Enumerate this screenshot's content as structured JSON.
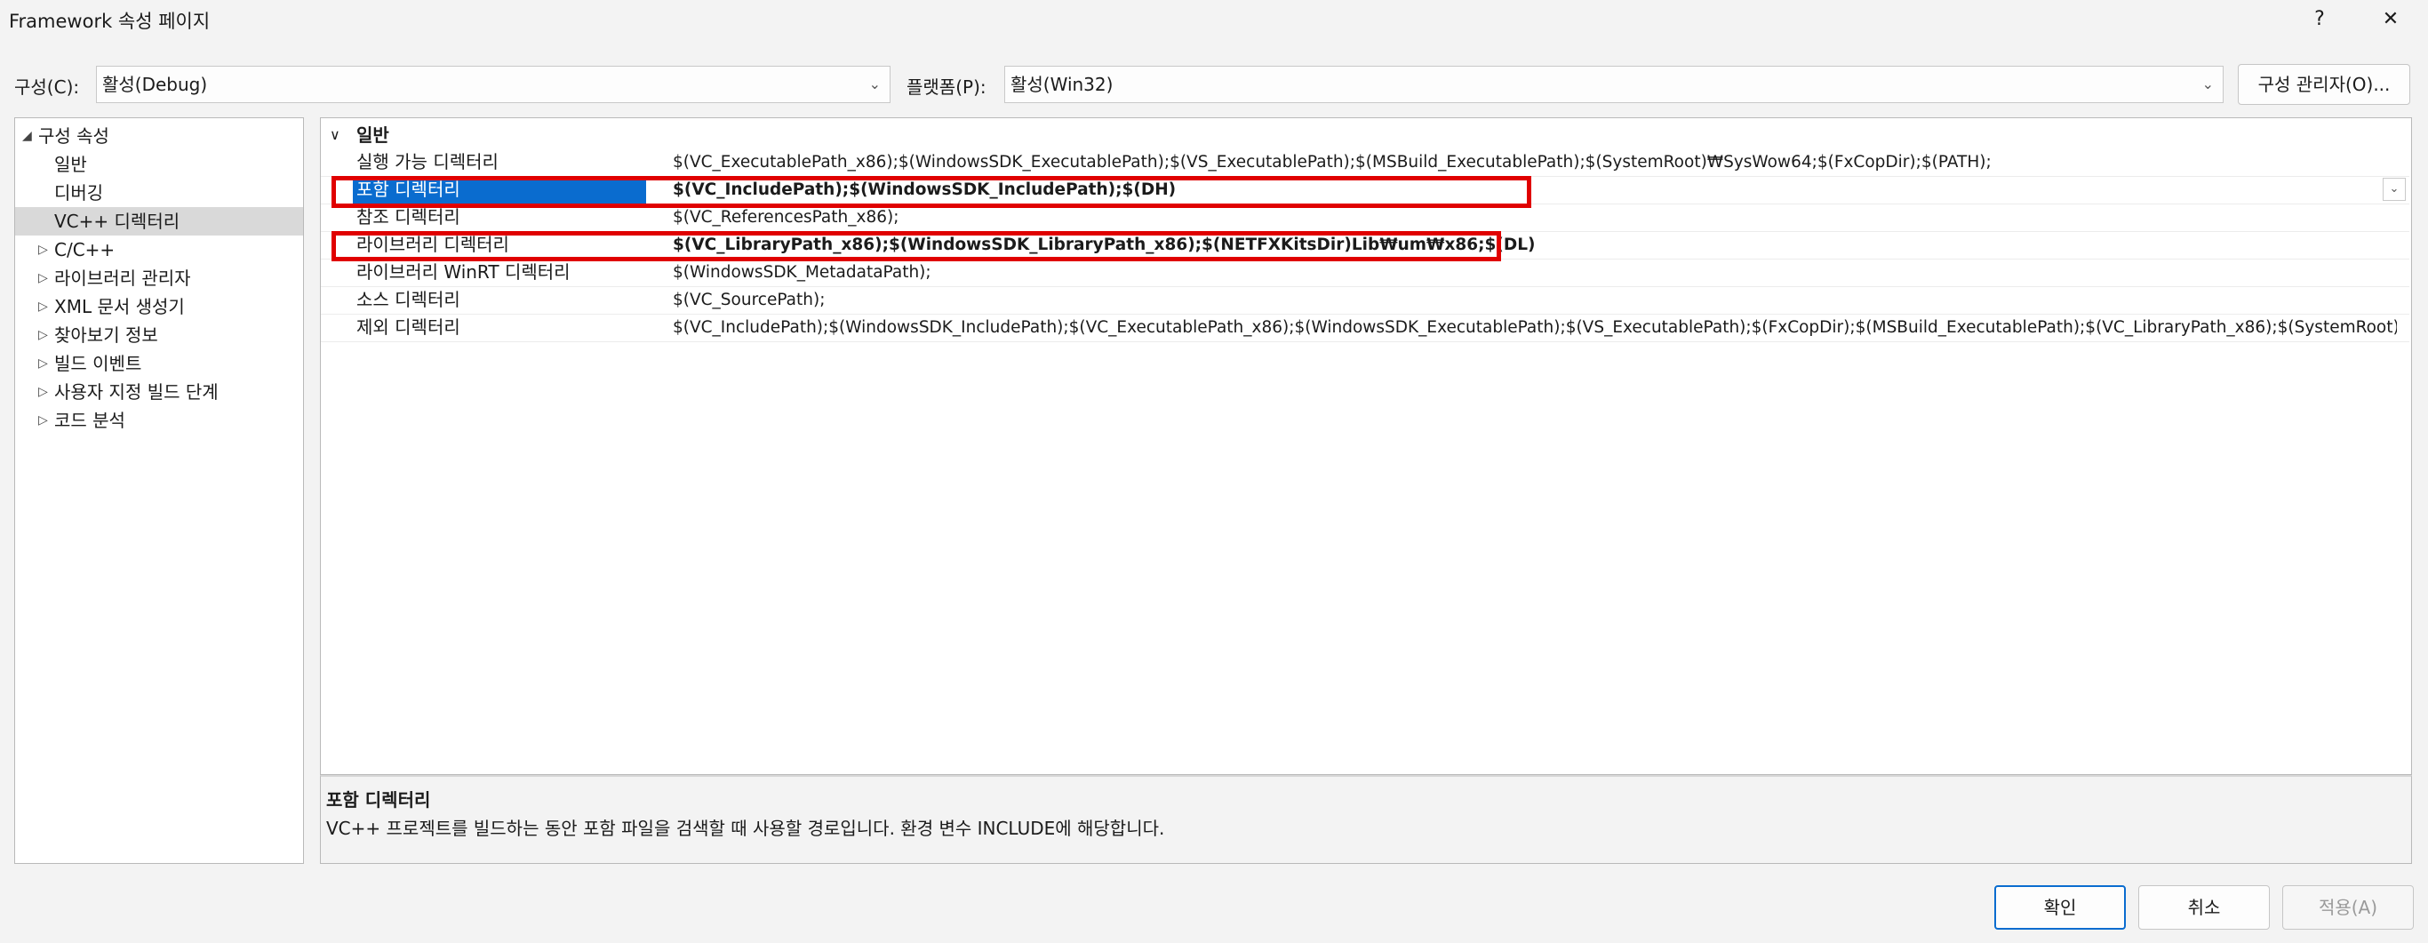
{
  "window": {
    "title": "Framework 속성 페이지",
    "help_label": "?",
    "close_label": "✕"
  },
  "config_bar": {
    "config_label": "구성(C):",
    "config_value": "활성(Debug)",
    "platform_label": "플랫폼(P):",
    "platform_value": "활성(Win32)",
    "manager_button": "구성 관리자(O)..."
  },
  "tree": {
    "items": [
      {
        "label": "구성 속성",
        "expander": "◢"
      },
      {
        "label": "일반",
        "expander": ""
      },
      {
        "label": "디버깅",
        "expander": ""
      },
      {
        "label": "VC++ 디렉터리",
        "expander": ""
      },
      {
        "label": "C/C++",
        "expander": "▷"
      },
      {
        "label": "라이브러리 관리자",
        "expander": "▷"
      },
      {
        "label": "XML 문서 생성기",
        "expander": "▷"
      },
      {
        "label": "찾아보기 정보",
        "expander": "▷"
      },
      {
        "label": "빌드 이벤트",
        "expander": "▷"
      },
      {
        "label": "사용자 지정 빌드 단계",
        "expander": "▷"
      },
      {
        "label": "코드 분석",
        "expander": "▷"
      }
    ],
    "selected": "VC++ 디렉터리"
  },
  "grid": {
    "category": "일반",
    "category_expander": "∨",
    "rows": [
      {
        "name": "실행 가능 디렉터리",
        "value": "$(VC_ExecutablePath_x86);$(WindowsSDK_ExecutablePath);$(VS_ExecutablePath);$(MSBuild_ExecutablePath);$(SystemRoot)₩SysWow64;$(FxCopDir);$(PATH);"
      },
      {
        "name": "포함 디렉터리",
        "value": "$(VC_IncludePath);$(WindowsSDK_IncludePath);$(DH)"
      },
      {
        "name": "참조 디렉터리",
        "value": "$(VC_ReferencesPath_x86);"
      },
      {
        "name": "라이브러리 디렉터리",
        "value": "$(VC_LibraryPath_x86);$(WindowsSDK_LibraryPath_x86);$(NETFXKitsDir)Lib₩um₩x86;$(DL)"
      },
      {
        "name": "라이브러리 WinRT 디렉터리",
        "value": "$(WindowsSDK_MetadataPath);"
      },
      {
        "name": "소스 디렉터리",
        "value": "$(VC_SourcePath);"
      },
      {
        "name": "제외 디렉터리",
        "value": "$(VC_IncludePath);$(WindowsSDK_IncludePath);$(VC_ExecutablePath_x86);$(WindowsSDK_ExecutablePath);$(VS_ExecutablePath);$(FxCopDir);$(MSBuild_ExecutablePath);$(VC_LibraryPath_x86);$(SystemRoot)"
      }
    ],
    "dropdown_glyph": "⌄"
  },
  "description": {
    "title": "포함 디렉터리",
    "body": "VC++ 프로젝트를 빌드하는 동안 포함 파일을 검색할 때 사용할 경로입니다.  환경 변수 INCLUDE에 해당합니다."
  },
  "buttons": {
    "ok": "확인",
    "cancel": "취소",
    "apply": "적용(A)"
  },
  "colors": {
    "selection_blue": "#0a6ccf",
    "highlight_red": "#e00000"
  }
}
